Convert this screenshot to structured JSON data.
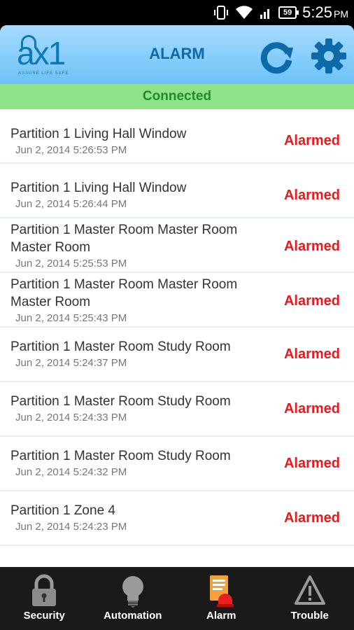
{
  "status_bar": {
    "time": "5:25",
    "time_suffix": "PM",
    "battery": "59"
  },
  "header": {
    "logo_text": "ax1",
    "logo_tagline": "ASSURE   LIFE SAFE",
    "title": "ALARM",
    "refresh_icon": "refresh-icon",
    "settings_icon": "gear-icon"
  },
  "connection": {
    "status": "Connected"
  },
  "alarms": [
    {
      "title": "Partition 1 Living Hall Window",
      "time": "Jun 2, 2014 5:26:53 PM",
      "status": "Alarmed"
    },
    {
      "title": "Partition 1 Living Hall Window",
      "time": "Jun 2, 2014 5:26:44 PM",
      "status": "Alarmed"
    },
    {
      "title": "Partition 1 Master Room Master Room Master Room",
      "time": "Jun 2, 2014 5:25:53 PM",
      "status": "Alarmed"
    },
    {
      "title": "Partition 1 Master Room Master Room Master Room",
      "time": "Jun 2, 2014 5:25:43 PM",
      "status": "Alarmed"
    },
    {
      "title": "Partition 1 Master Room Study Room",
      "time": "Jun 2, 2014 5:24:37 PM",
      "status": "Alarmed"
    },
    {
      "title": "Partition 1 Master Room Study Room",
      "time": "Jun 2, 2014 5:24:33 PM",
      "status": "Alarmed"
    },
    {
      "title": "Partition 1 Master Room Study Room",
      "time": "Jun 2, 2014 5:24:32 PM",
      "status": "Alarmed"
    },
    {
      "title": "Partition 1 Zone 4",
      "time": "Jun 2, 2014 5:24:23 PM",
      "status": "Alarmed"
    }
  ],
  "tabs": [
    {
      "label": "Security",
      "icon": "lock-icon"
    },
    {
      "label": "Automation",
      "icon": "bulb-icon"
    },
    {
      "label": "Alarm",
      "icon": "alarm-icon"
    },
    {
      "label": "Trouble",
      "icon": "warning-icon"
    }
  ],
  "colors": {
    "header_top": "#a6dbff",
    "header_bottom": "#6cc2f7",
    "brand_blue": "#0d78b8",
    "connected_bg": "#8fe28a",
    "connected_text": "#1f8c2c",
    "alarm_red": "#e8181c",
    "tabbar_bg": "#1a1a1a"
  }
}
